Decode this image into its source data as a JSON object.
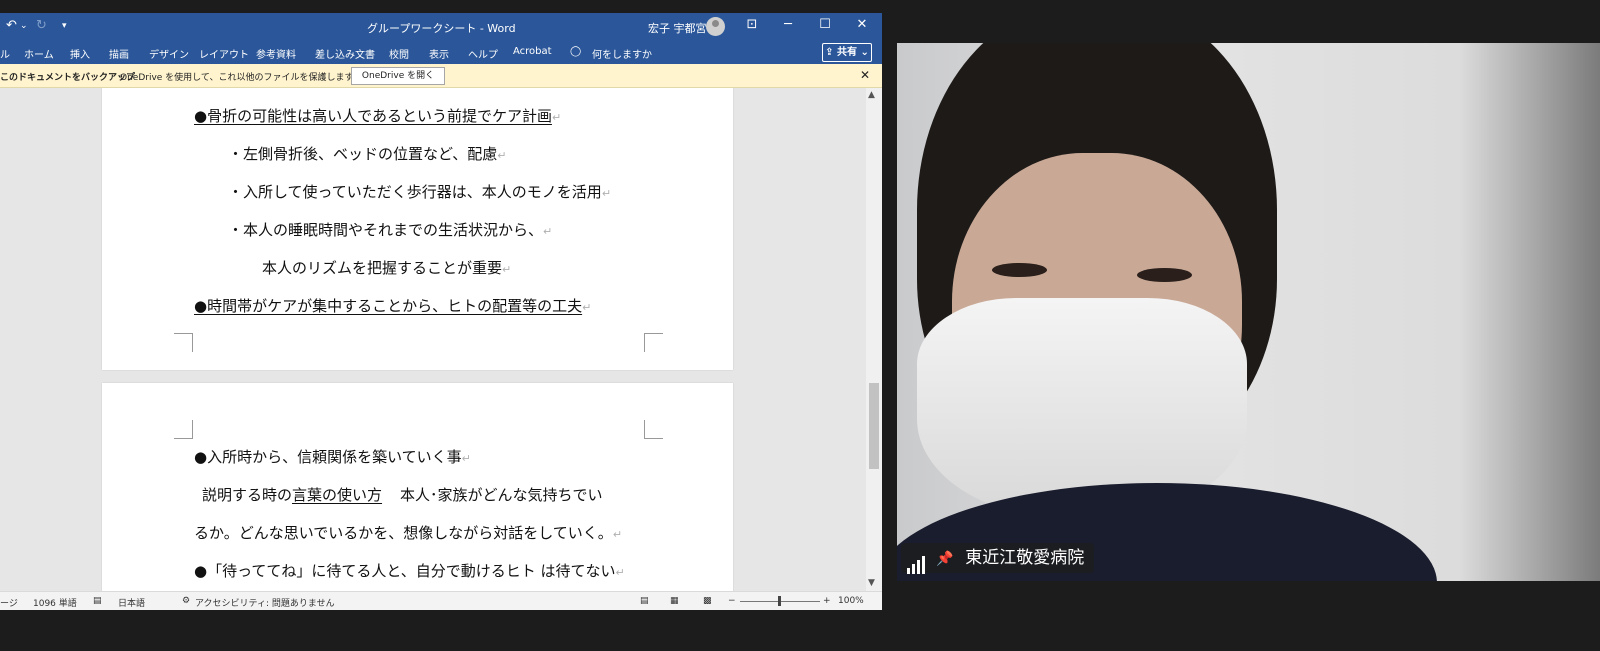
{
  "window": {
    "title": "グループワークシート - Word",
    "user_name": "宏子 宇都宮",
    "quick_access": [
      "↶",
      "⌄",
      "↻",
      "▾"
    ],
    "controls": {
      "ribbon_display": "⊡",
      "minimize": "─",
      "maximize": "☐",
      "close": "✕"
    }
  },
  "ribbon": {
    "tabs": [
      "ル",
      "ホーム",
      "挿入",
      "描画",
      "デザイン",
      "レイアウト",
      "参考資料",
      "差し込み文書",
      "校閲",
      "表示",
      "ヘルプ",
      "Acrobat"
    ],
    "tell_me_icon": "lightbulb-icon",
    "tell_me": "何をしますか",
    "share_label": "⇪ 共有 ⌄"
  },
  "infobar": {
    "title": "このドキュメントをバックアップ",
    "message": "OneDrive を使用して、これ以他のファイルを保護します。",
    "button_label": "OneDrive を開く",
    "close": "✕"
  },
  "document": {
    "page1_lines": [
      "●骨折の可能性は高い人であるという前提でケア計画",
      "・左側骨折後、ベッドの位置など、配慮",
      "・入所して使っていただく歩行器は、本人のモノを活用",
      "・本人の睡眠時間やそれまでの生活状況から、",
      "本人のリズムを把握することが重要",
      "●時間帯がケアが集中することから、ヒトの配置等の工夫"
    ],
    "page2_lines": [
      "●入所時から、信頼関係を築いていく事",
      "説明する時の",
      "言葉の使い方",
      "本人･家族がどんな気持ちでい",
      "るか。どんな思いでいるかを、想像しながら対話をしていく。",
      "●「待っててね」に待てる人と、自分で動けるヒト  は待てない"
    ],
    "paragraph_mark": "↵"
  },
  "statusbar": {
    "page_label": "ージ",
    "word_count": "1096 単語",
    "language": "日本語",
    "accessibility": "アクセシビリティ: 問題ありません",
    "zoom": "100%",
    "zoom_minus": "−",
    "zoom_plus": "+"
  },
  "video": {
    "participant_name": "東近江敬愛病院",
    "pin_icon": "📌"
  },
  "colors": {
    "word_blue": "#2b579a",
    "infobar_yellow": "#fff4ce",
    "background": "#1c1c1c"
  }
}
